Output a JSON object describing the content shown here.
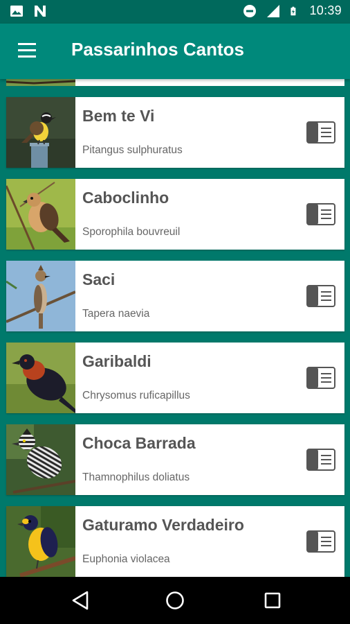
{
  "status_bar": {
    "time": "10:39",
    "icons": [
      "image-icon",
      "n-icon",
      "do-not-disturb-icon",
      "signal-icon",
      "battery-charging-icon"
    ]
  },
  "app_bar": {
    "title": "Passarinhos Cantos",
    "menu_icon": "hamburger-menu-icon"
  },
  "birds": [
    {
      "name": "Bem te Vi",
      "scientific": "Pitangus sulphuratus",
      "thumb": "bem-te-vi-photo"
    },
    {
      "name": "Caboclinho",
      "scientific": "Sporophila bouvreuil",
      "thumb": "caboclinho-photo"
    },
    {
      "name": "Saci",
      "scientific": "Tapera naevia",
      "thumb": "saci-photo"
    },
    {
      "name": "Garibaldi",
      "scientific": "Chrysomus ruficapillus",
      "thumb": "garibaldi-photo"
    },
    {
      "name": "Choca Barrada",
      "scientific": "Thamnophilus doliatus",
      "thumb": "choca-barrada-photo"
    },
    {
      "name": "Gaturamo Verdadeiro",
      "scientific": "Euphonia violacea",
      "thumb": "gaturamo-photo"
    }
  ],
  "nav_bar": {
    "back_icon": "back-triangle-icon",
    "home_icon": "home-circle-icon",
    "recents_icon": "recents-square-icon"
  },
  "colors": {
    "primary": "#00897b",
    "primary_dark": "#00695c",
    "background": "#00796b",
    "card": "#ffffff",
    "title_text": "#555555",
    "subtitle_text": "#666666"
  }
}
